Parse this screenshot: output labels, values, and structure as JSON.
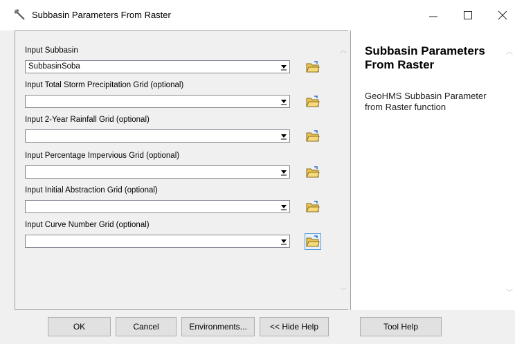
{
  "window": {
    "title": "Subbasin Parameters From Raster",
    "minimize_symbol": "—",
    "maximize_symbol": "☐",
    "close_symbol": "✕"
  },
  "fields": [
    {
      "label": "Input Subbasin",
      "value": ""
    },
    {
      "label": "Input Total Storm Precipitation Grid (optional)",
      "value": ""
    },
    {
      "label": "Input 2-Year Rainfall Grid (optional)",
      "value": ""
    },
    {
      "label": "Input Percentage Impervious Grid (optional)",
      "value": ""
    },
    {
      "label": "Input Initial Abstraction Grid (optional)",
      "value": ""
    },
    {
      "label": "Input Curve Number Grid (optional)",
      "value": ""
    }
  ],
  "subbasin_value": "SubbasinSoba",
  "help": {
    "title": "Subbasin Parameters From Raster",
    "body": "GeoHMS Subbasin Parameter from Raster function"
  },
  "buttons": {
    "ok": "OK",
    "cancel": "Cancel",
    "environments": "Environments...",
    "hide_help": "<< Hide Help",
    "tool_help": "Tool Help"
  },
  "icons": {
    "app": "hammer-icon",
    "browse": "open-folder-icon",
    "dropdown": "dropdown-arrow-icon"
  }
}
